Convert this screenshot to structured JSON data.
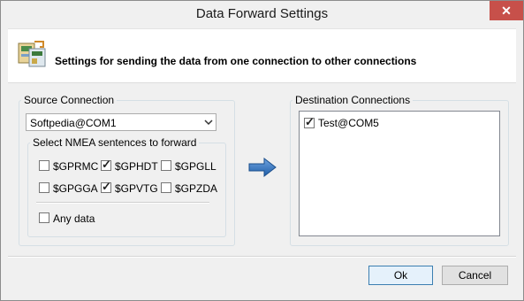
{
  "window": {
    "title": "Data Forward Settings",
    "close_glyph": "✕"
  },
  "header": {
    "icon": "network-cards-icon",
    "text": "Settings for sending the data from one connection to other connections"
  },
  "source": {
    "legend": "Source Connection",
    "selected": "Softpedia@COM1",
    "nmea_legend": "Select NMEA sentences to forward",
    "sentences": [
      {
        "label": "$GPRMC",
        "checked": false
      },
      {
        "label": "$GPHDT",
        "checked": true
      },
      {
        "label": "$GPGLL",
        "checked": false
      },
      {
        "label": "$GPGGA",
        "checked": false
      },
      {
        "label": "$GPVTG",
        "checked": true
      },
      {
        "label": "$GPZDA",
        "checked": false
      }
    ],
    "any_data": {
      "label": "Any data",
      "checked": false
    }
  },
  "forward_arrow_icon": "arrow-right-icon",
  "destination": {
    "legend": "Destination Connections",
    "items": [
      {
        "label": "Test@COM5",
        "checked": true
      }
    ]
  },
  "buttons": {
    "ok": "Ok",
    "cancel": "Cancel"
  },
  "colors": {
    "arrow": "#2f6fb7",
    "close": "#c7504a"
  }
}
